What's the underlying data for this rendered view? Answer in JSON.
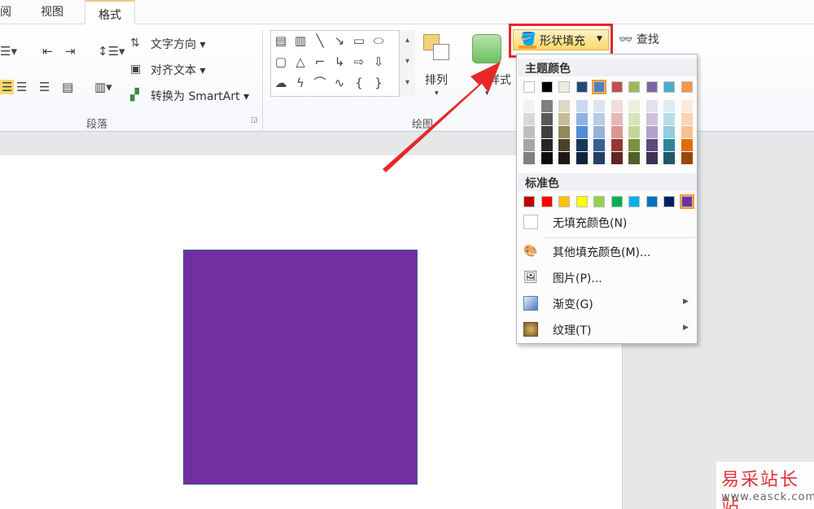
{
  "tabs": {
    "review_partial": "阅",
    "view": "视图",
    "format": "格式"
  },
  "ribbon": {
    "paragraph": {
      "text_direction": "文字方向",
      "align_text": "对齐文本",
      "convert_smartart": "转换为 SmartArt",
      "group_label": "段落"
    },
    "drawing": {
      "arrange_label": "排列",
      "quick_styles_label": "样式",
      "group_label": "绘图",
      "shape_fill_button": "形状填充",
      "find_button": "查找"
    }
  },
  "fill_menu": {
    "theme_colors_label": "主题颜色",
    "standard_colors_label": "标准色",
    "theme_colors": [
      "#ffffff",
      "#000000",
      "#eeece1",
      "#1f497d",
      "#4f81bd",
      "#c0504d",
      "#9bbb59",
      "#8064a2",
      "#4bacc6",
      "#f79646"
    ],
    "theme_tints": [
      [
        "#f2f2f2",
        "#d8d8d8",
        "#bfbfbf",
        "#a5a5a5",
        "#7f7f7f"
      ],
      [
        "#7f7f7f",
        "#595959",
        "#3f3f3f",
        "#262626",
        "#0c0c0c"
      ],
      [
        "#ddd9c3",
        "#c4bd97",
        "#938953",
        "#494429",
        "#1d1b10"
      ],
      [
        "#c6d9f0",
        "#8db3e2",
        "#548dd4",
        "#17365d",
        "#0f243e"
      ],
      [
        "#dbe5f1",
        "#b8cce4",
        "#95b3d7",
        "#366092",
        "#244061"
      ],
      [
        "#f2dcdb",
        "#e5b9b7",
        "#d99694",
        "#953734",
        "#632423"
      ],
      [
        "#ebf1dd",
        "#d7e3bc",
        "#c3d69b",
        "#76923c",
        "#4f6128"
      ],
      [
        "#e5e0ec",
        "#ccc1d9",
        "#b2a2c7",
        "#5f497a",
        "#3f3151"
      ],
      [
        "#dbeef3",
        "#b7dde8",
        "#92cddc",
        "#31859b",
        "#205867"
      ],
      [
        "#fdeada",
        "#fbd5b5",
        "#fac08f",
        "#e36c09",
        "#974806"
      ]
    ],
    "standard_colors": [
      "#c00000",
      "#ff0000",
      "#ffc000",
      "#ffff00",
      "#92d050",
      "#00b050",
      "#00b0f0",
      "#0070c0",
      "#002060",
      "#7030a0"
    ],
    "selected_theme_index": 4,
    "selected_standard_index": 9,
    "no_fill": "无填充颜色(N)",
    "more_fill_colors": "其他填充颜色(M)...",
    "picture": "图片(P)...",
    "gradient": "渐变(G)",
    "texture": "纹理(T)"
  },
  "slide": {
    "shape_fill_color": "#7030a0"
  },
  "watermark": {
    "title": "易采站长站",
    "url": "www.easck.com"
  }
}
